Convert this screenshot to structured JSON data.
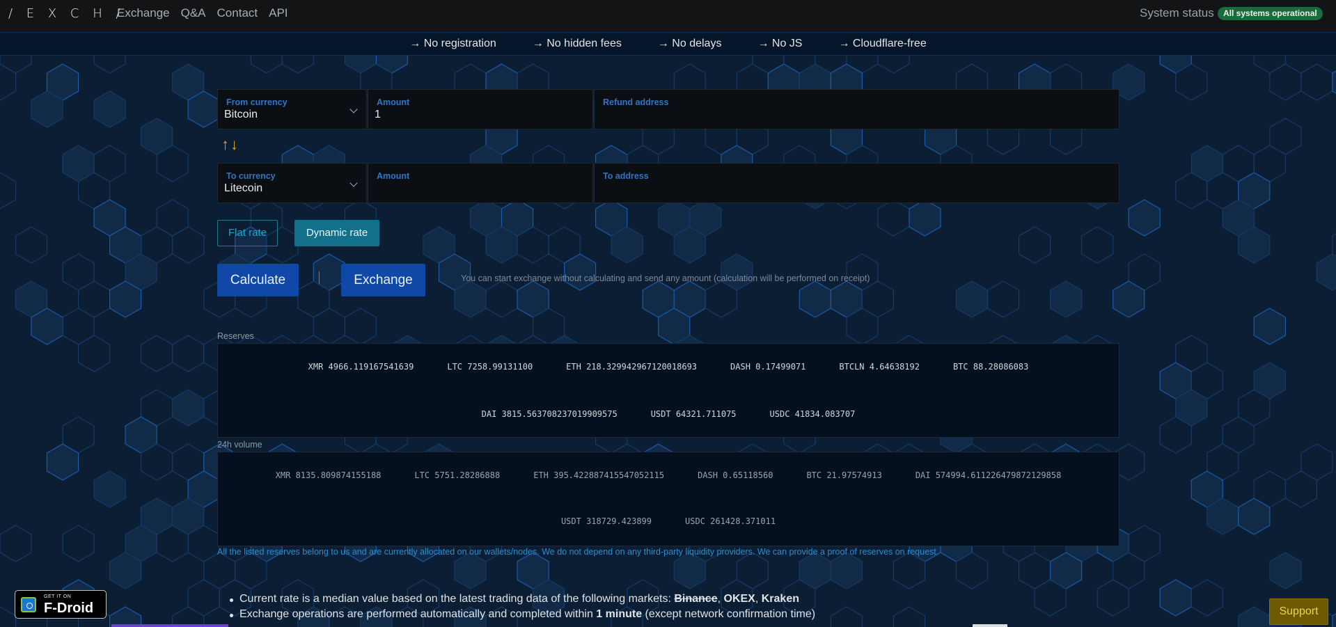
{
  "nav": {
    "brand": "/ E X C H /",
    "links": [
      "Exchange",
      "Q&A",
      "Contact",
      "API"
    ],
    "status_label": "System status",
    "status_badge": "All systems operational",
    "status_color": "#1c6b3c"
  },
  "features": [
    "→ No registration",
    "→ No hidden fees",
    "→ No delays",
    "→ No JS",
    "→ Cloudflare-free"
  ],
  "form": {
    "from_currency_label": "From currency",
    "from_currency_value": "Bitcoin",
    "from_amount_label": "Amount",
    "from_amount_value": "1",
    "refund_label": "Refund address",
    "refund_value": "",
    "swap_icon": "↑↓",
    "to_currency_label": "To currency",
    "to_currency_value": "Litecoin",
    "to_amount_label": "Amount",
    "to_amount_value": "",
    "to_address_label": "To address",
    "to_address_value": ""
  },
  "rate": {
    "flat": "Flat rate",
    "dynamic": "Dynamic rate",
    "selected": "Dynamic rate"
  },
  "actions": {
    "calculate": "Calculate",
    "exchange": "Exchange",
    "hint": "You can start exchange without calculating and send any amount (calculation will be performed on receipt)"
  },
  "reserves": {
    "label": "Reserves",
    "row1": [
      "XMR 4966.119167541639",
      "LTC 7258.99131100",
      "ETH 218.329942967120018693",
      "DASH 0.17499071",
      "BTCLN 4.64638192",
      "BTC 88.28086083"
    ],
    "row2": [
      "DAI 3815.563708237019909575",
      "USDT 64321.711075",
      "USDC 41834.083707"
    ]
  },
  "volume": {
    "label": "24h volume",
    "row1": [
      "XMR 8135.809874155188",
      "LTC 5751.28286888",
      "ETH 395.422887415547052115",
      "DASH 0.65118560",
      "BTC 21.97574913",
      "DAI 574994.611226479872129858"
    ],
    "row2": [
      "USDT 318729.423899",
      "USDC 261428.371011"
    ]
  },
  "note": "All the listed reserves belong to us and are currently allocated on our wallets/nodes. We do not depend on any third-party liquidity providers. We can provide a proof of reserves on request.",
  "info": {
    "line1_prefix": "Current rate is a median value based on the latest trading data of the following markets: ",
    "market_struck": "Binance",
    "sep": ", ",
    "market2": "OKEX",
    "market3": "Kraken",
    "line2_prefix": "Exchange operations are performed automatically and completed within ",
    "line2_bold": "1 minute",
    "line2_suffix": " (except network confirmation time)"
  },
  "fdroid": {
    "get_it_on": "GET IT ON",
    "name": "F-Droid"
  },
  "support": "Support",
  "accent": {
    "brand_blue": "#0f48a6",
    "teal": "#12708a",
    "gold": "#e0a51a"
  }
}
